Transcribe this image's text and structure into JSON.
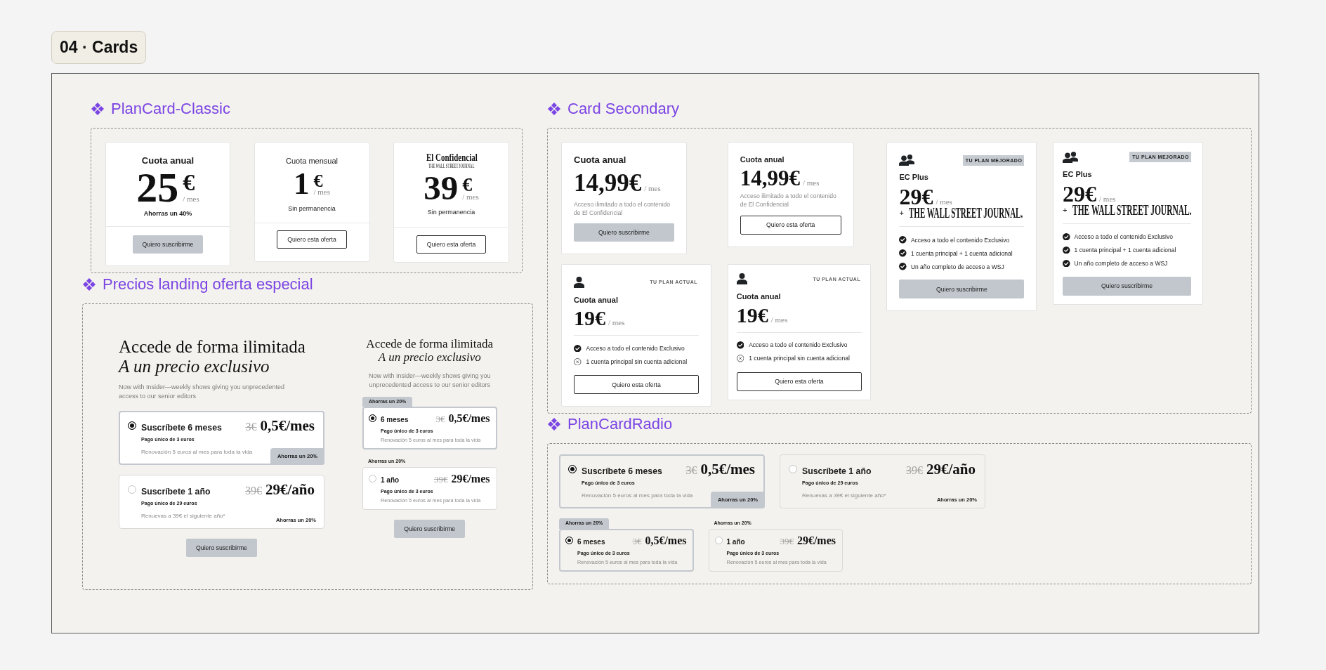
{
  "title": "04 · Cards",
  "sections": [
    {
      "kind": "classic",
      "title": "PlanCard-Classic",
      "cards": [
        {
          "kind": "featured",
          "heading": "Cuota anual",
          "amount": "25",
          "currency": "€",
          "period": "/ mes",
          "note": "Ahorras un 40%",
          "button": {
            "label": "Quiero suscribirme",
            "kind": "filled"
          }
        },
        {
          "kind": "plain",
          "heading": "Cuota mensual",
          "amount": "1",
          "currency": "€",
          "period": "/ mes",
          "note": "Sin permanencia",
          "button": {
            "label": "Quiero esta oferta",
            "kind": "outline"
          }
        },
        {
          "kind": "logo",
          "logo": "El Confidencial",
          "partner": "THE WALL STREET JOURNAL",
          "amount": "39",
          "currency": "€",
          "period": "/ mes",
          "note": "Sin permanencia",
          "button": {
            "label": "Quiero esta oferta",
            "kind": "outline"
          }
        }
      ]
    },
    {
      "kind": "secondary",
      "title": "Card Secondary",
      "cards": [
        {
          "kind": "basic",
          "heading": "Cuota anual",
          "price": "14,99€",
          "period": "/ mes",
          "description": "Acceso ilimitado a todo el contenido de El Confidencial",
          "button": {
            "label": "Quiero suscribirme",
            "kind": "filled"
          }
        },
        {
          "kind": "basic",
          "heading": "Cuota anual",
          "price": "14,99€",
          "period": "/ mes",
          "description": "Acceso ilimitado a todo el contenido de El Confidencial",
          "button": {
            "label": "Quiero esta oferta",
            "kind": "outline"
          }
        },
        {
          "kind": "upgraded",
          "tag": "TU PLAN MEJORADO",
          "heading": "EC Plus",
          "price": "29€",
          "period": "/ mes",
          "partner": {
            "prefix": "+",
            "name": "THE WALL STREET JOURNAL."
          },
          "features": [
            {
              "label": "Acceso a todo el contenido Exclusivo",
              "included": true
            },
            {
              "label": "1 cuenta principal + 1 cuenta adicional",
              "included": true
            },
            {
              "label": "Un año completo de acceso a WSJ",
              "included": true
            }
          ],
          "button": {
            "label": "Quiero suscribirme",
            "kind": "filled"
          }
        },
        {
          "kind": "upgraded",
          "tag": "TU PLAN MEJORADO",
          "heading": "EC Plus",
          "price": "29€",
          "period": "/ mes",
          "partner": {
            "prefix": "+",
            "name": "THE WALL STREET JOURNAL."
          },
          "features": [
            {
              "label": "Acceso a todo el contenido Exclusivo",
              "included": true
            },
            {
              "label": "1 cuenta principal + 1 cuenta adicional",
              "included": true
            },
            {
              "label": "Un año completo de acceso a WSJ",
              "included": true
            }
          ],
          "button": {
            "label": "Quiero suscribirme",
            "kind": "filled"
          }
        },
        {
          "kind": "current",
          "tag": "TU PLAN ACTUAL",
          "heading": "Cuota anual",
          "price": "19€",
          "period": "/ mes",
          "features": [
            {
              "label": "Acceso a todo el contenido Exclusivo",
              "included": true
            },
            {
              "label": "1 cuenta principal sin cuenta adicional",
              "included": false
            }
          ],
          "button": {
            "label": "Quiero esta oferta",
            "kind": "outline"
          }
        },
        {
          "kind": "current",
          "tag": "TU PLAN ACTUAL",
          "heading": "Cuota anual",
          "price": "19€",
          "period": "/ mes",
          "features": [
            {
              "label": "Acceso a todo el contenido Exclusivo",
              "included": true
            },
            {
              "label": "1 cuenta principal sin cuenta adicional",
              "included": false
            }
          ],
          "button": {
            "label": "Quiero esta oferta",
            "kind": "outline"
          }
        }
      ]
    },
    {
      "kind": "landing",
      "title": "Precios landing oferta especial",
      "variants": [
        {
          "kind": "large",
          "heading": "Accede de forma ilimitada",
          "subheading": "A un precio exclusivo",
          "description": "Now with Insider—weekly shows giving you unprecedented access to our senior editors",
          "options": [
            {
              "title": "Suscríbete 6 meses",
              "old_price": "3€",
              "price": "0,5€/mes",
              "payment": "Pago único de 3 euros",
              "renewal": "Renovación 5 euros al mes para toda la vida",
              "savings": "Ahorras un 20%",
              "selected": true
            },
            {
              "title": "Suscríbete 1 año",
              "old_price": "39€",
              "price": "29€/año",
              "payment": "Pago único de 29 euros",
              "renewal": "Renuevas a 39€ el siguiente año*",
              "savings": "Ahorras un 20%",
              "selected": false
            }
          ],
          "button": {
            "label": "Quiero suscribirme",
            "kind": "filled"
          }
        },
        {
          "kind": "compact",
          "heading": "Accede de forma ilimitada",
          "subheading": "A un precio exclusivo",
          "description": "Now with Insider—weekly shows giving you unprecedented access to our senior editors",
          "options": [
            {
              "title": "6 meses",
              "old_price": "3€",
              "price": "0,5€/mes",
              "payment": "Pago único de 3 euros",
              "renewal": "Renovación 5 euros al mes para toda la vida",
              "savings": "Ahorras un 20%",
              "selected": true
            },
            {
              "title": "1 año",
              "old_price": "39€",
              "price": "29€/mes",
              "payment": "Pago único de 3 euros",
              "renewal": "Renovación 5 euros al mes para toda la vida",
              "savings": "Ahorras un 20%",
              "selected": false
            }
          ],
          "button": {
            "label": "Quiero suscribirme",
            "kind": "filled"
          }
        }
      ]
    },
    {
      "kind": "radio",
      "title": "PlanCardRadio",
      "groups": [
        {
          "kind": "large",
          "options": [
            {
              "title": "Suscríbete 6 meses",
              "old_price": "3€",
              "price": "0,5€/mes",
              "payment": "Pago único de 3 euros",
              "renewal": "Renovación 5 euros al mes para toda la vida",
              "savings": "Ahorras un 20%",
              "selected": true
            },
            {
              "title": "Suscríbete 1 año",
              "old_price": "39€",
              "price": "29€/año",
              "payment": "Pago único de 29 euros",
              "renewal": "Renuevas a 39€ el siguiente año*",
              "savings": "Ahorras un 20%",
              "selected": false
            }
          ]
        },
        {
          "kind": "compact",
          "options": [
            {
              "title": "6 meses",
              "old_price": "3€",
              "price": "0,5€/mes",
              "payment": "Pago único de 3 euros",
              "renewal": "Renovación 5 euros al mes para toda la vida",
              "savings": "Ahorras un 20%",
              "selected": true
            },
            {
              "title": "1 año",
              "old_price": "39€",
              "price": "29€/mes",
              "payment": "Pago único de 3 euros",
              "renewal": "Renovación 5 euros al mes para toda la vida",
              "savings": "Ahorras un 20%",
              "selected": false
            }
          ]
        }
      ]
    }
  ]
}
